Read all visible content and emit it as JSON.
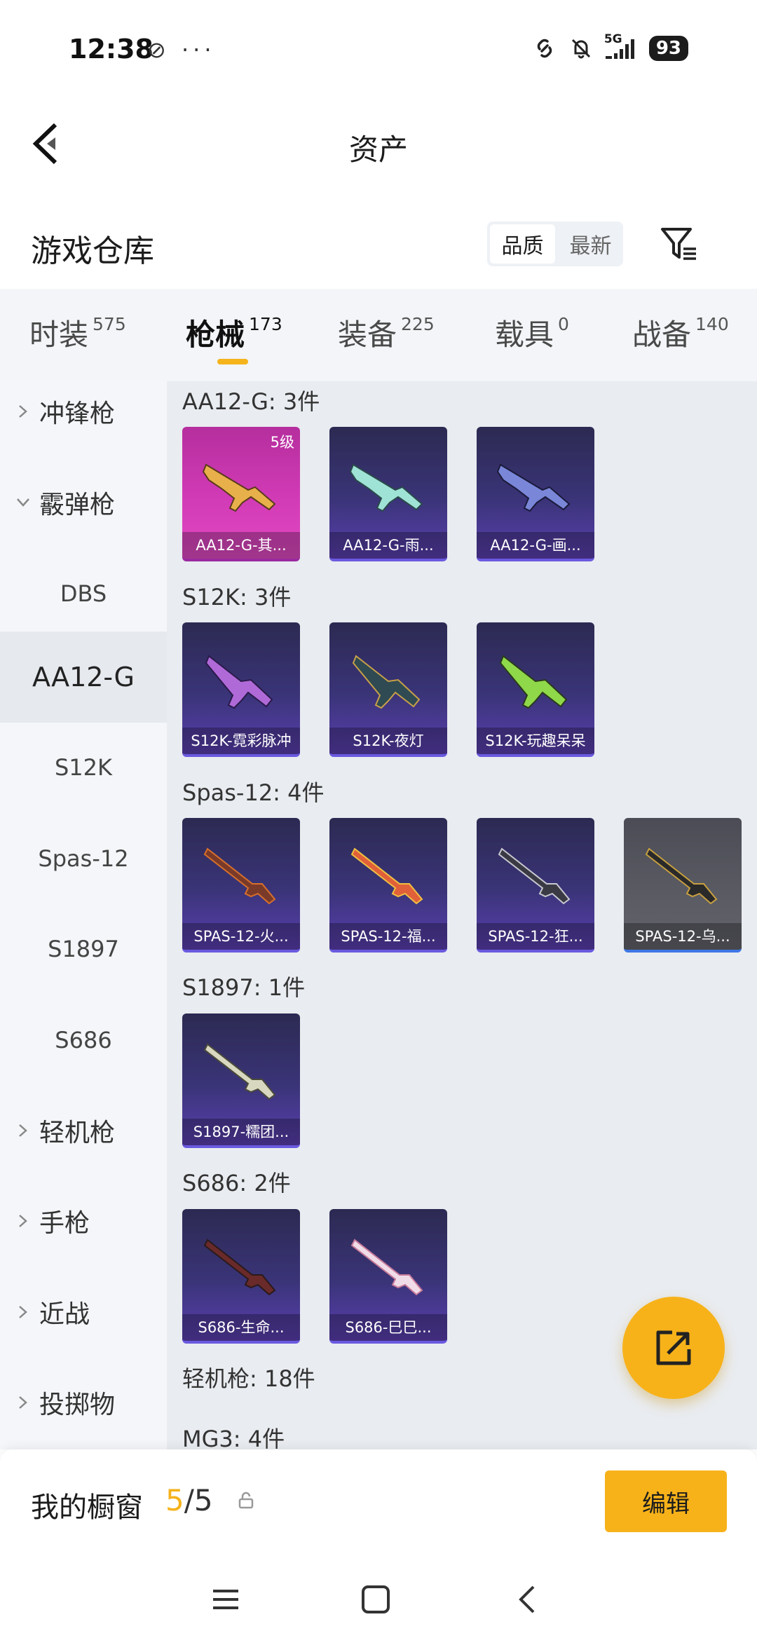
{
  "status_bar": {
    "time": "12:38",
    "left_extra": "⊘ ···",
    "network": "5G",
    "battery": "93"
  },
  "header": {
    "title": "资产"
  },
  "warehouse": {
    "title": "游戏仓库",
    "sort_options": [
      "品质",
      "最新"
    ],
    "sort_selected": "品质"
  },
  "tabs": [
    {
      "label": "时装",
      "count": "575"
    },
    {
      "label": "枪械",
      "count": "173"
    },
    {
      "label": "装备",
      "count": "225"
    },
    {
      "label": "载具",
      "count": "0"
    },
    {
      "label": "战备",
      "count": "140"
    }
  ],
  "active_tab": "枪械",
  "sidebar": {
    "items": [
      {
        "type": "group",
        "label": "冲锋枪",
        "expanded": false
      },
      {
        "type": "group",
        "label": "霰弹枪",
        "expanded": true
      },
      {
        "type": "sub",
        "label": "DBS"
      },
      {
        "type": "sub",
        "label": "AA12-G",
        "active": true
      },
      {
        "type": "sub",
        "label": "S12K"
      },
      {
        "type": "sub",
        "label": "Spas-12"
      },
      {
        "type": "sub",
        "label": "S1897"
      },
      {
        "type": "sub",
        "label": "S686"
      },
      {
        "type": "group",
        "label": "轻机枪",
        "expanded": false
      },
      {
        "type": "group",
        "label": "手枪",
        "expanded": false
      },
      {
        "type": "group",
        "label": "近战",
        "expanded": false
      },
      {
        "type": "group",
        "label": "投掷物",
        "expanded": false
      }
    ]
  },
  "sections": [
    {
      "title": "AA12-G: 3件",
      "items": [
        {
          "name": "AA12-G-其...",
          "rarity": "gold",
          "level": "5级"
        },
        {
          "name": "AA12-G-雨...",
          "rarity": "purple"
        },
        {
          "name": "AA12-G-画...",
          "rarity": "purple"
        }
      ]
    },
    {
      "title": "S12K: 3件",
      "items": [
        {
          "name": "S12K-霓彩脉冲",
          "rarity": "purple"
        },
        {
          "name": "S12K-夜灯",
          "rarity": "purple"
        },
        {
          "name": "S12K-玩趣呆呆",
          "rarity": "purple"
        }
      ]
    },
    {
      "title": "Spas-12: 4件",
      "items": [
        {
          "name": "SPAS-12-火...",
          "rarity": "purple"
        },
        {
          "name": "SPAS-12-福...",
          "rarity": "purple"
        },
        {
          "name": "SPAS-12-狂...",
          "rarity": "purple"
        },
        {
          "name": "SPAS-12-乌...",
          "rarity": "grey"
        }
      ]
    },
    {
      "title": "S1897: 1件",
      "items": [
        {
          "name": "S1897-糯团...",
          "rarity": "purple"
        }
      ]
    },
    {
      "title": "S686: 2件",
      "items": [
        {
          "name": "S686-生命...",
          "rarity": "purple"
        },
        {
          "name": "S686-巳巳...",
          "rarity": "purple"
        }
      ]
    },
    {
      "title": "轻机枪: 18件",
      "items": []
    },
    {
      "title": "MG3: 4件",
      "items": []
    }
  ],
  "bottom": {
    "window_title": "我的橱窗",
    "window_current": "5",
    "window_total": "/5",
    "edit_label": "编辑"
  },
  "colors": {
    "accent": "#f7b21a",
    "card_purple": "#3a3478",
    "card_gold": "#d23bb6",
    "card_grey": "#5a5b63"
  }
}
